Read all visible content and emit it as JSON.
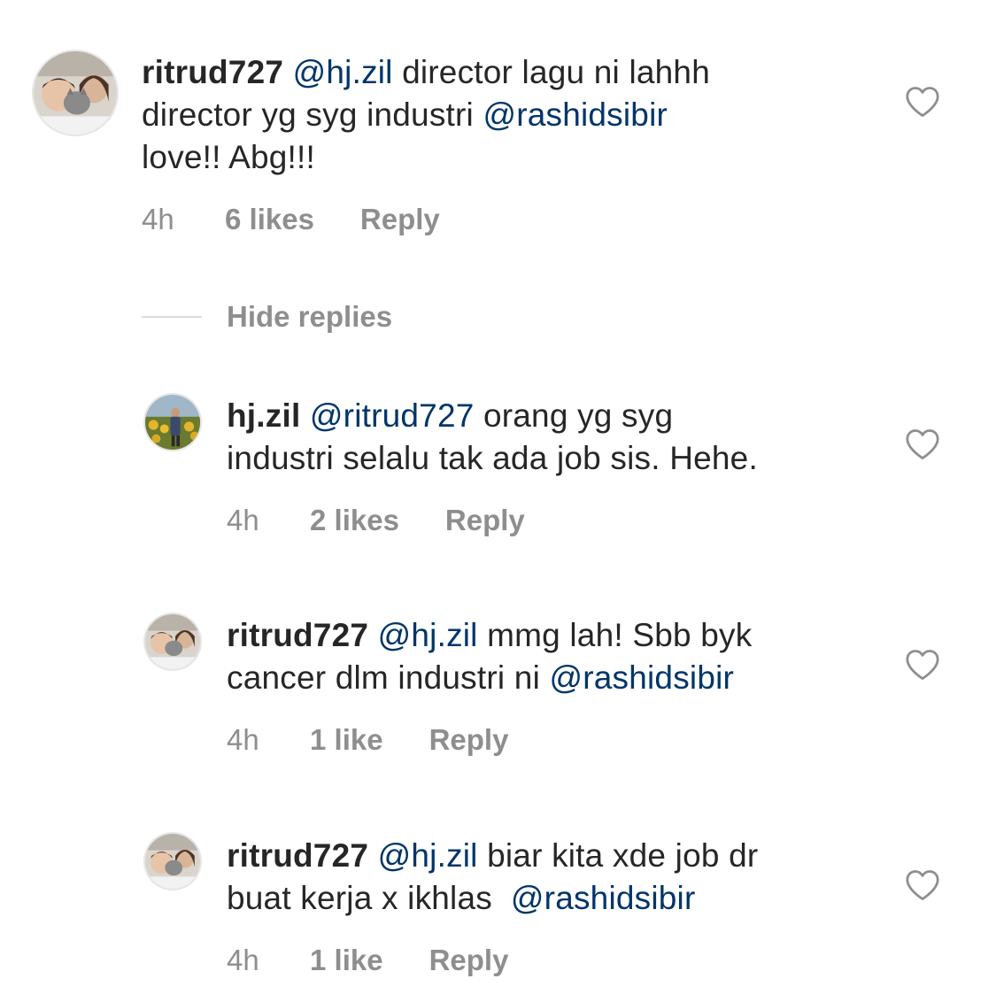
{
  "comments": [
    {
      "username": "ritrud727",
      "mention1": "@hj.zil",
      "text1": " director lagu ni lahhh\ndirector yg syg industri ",
      "mention2": "@rashidsibir",
      "text2": "\nlove!! Abg!!!",
      "time": "4h",
      "likes": "6 likes",
      "reply": "Reply",
      "avatar_icon": "avatar-kids-with-cat"
    },
    {
      "username": "hj.zil",
      "mention1": "@ritrud727",
      "text1": " orang yg syg\nindustri selalu tak ada job sis. Hehe.",
      "mention2": "",
      "text2": "",
      "time": "4h",
      "likes": "2 likes",
      "reply": "Reply",
      "avatar_icon": "avatar-man-sunflower-field"
    },
    {
      "username": "ritrud727",
      "mention1": "@hj.zil",
      "text1": " mmg lah! Sbb byk\ncancer dlm industri ni ",
      "mention2": "@rashidsibir",
      "text2": "",
      "time": "4h",
      "likes": "1 like",
      "reply": "Reply",
      "avatar_icon": "avatar-kids-with-cat"
    },
    {
      "username": "ritrud727",
      "mention1": "@hj.zil",
      "text1": " biar kita xde job dr\nbuat kerja x ikhlas  ",
      "mention2": "@rashidsibir",
      "text2": "",
      "time": "4h",
      "likes": "1 like",
      "reply": "Reply",
      "avatar_icon": "avatar-kids-with-cat"
    }
  ],
  "hide_replies_label": "Hide replies",
  "colors": {
    "text": "#262626",
    "mention": "#003569",
    "meta": "#8e8e8e",
    "divider": "#dbdbdb"
  },
  "icons": {
    "like": "heart-outline-icon"
  }
}
